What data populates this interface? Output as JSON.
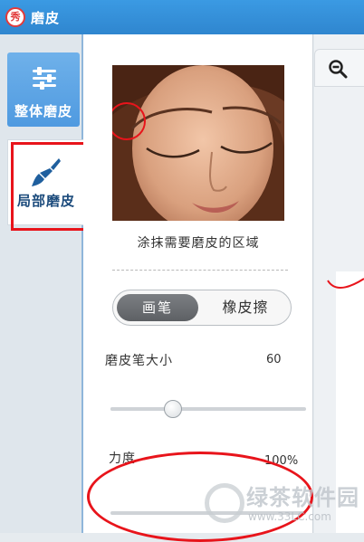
{
  "titlebar": {
    "app_logo_text": "秀",
    "title": "磨皮"
  },
  "sidebar": {
    "tabs": [
      {
        "label": "整体磨皮",
        "icon": "sliders-icon",
        "active": false
      },
      {
        "label": "局部磨皮",
        "icon": "brush-icon",
        "active": true
      }
    ]
  },
  "panel": {
    "preview_caption": "涂抹需要磨皮的区域",
    "mode_toggle": {
      "options": [
        "画笔",
        "橡皮擦"
      ],
      "selected": "画笔"
    },
    "brush_size": {
      "label": "磨皮笔大小",
      "value": "60",
      "level": 0.32
    },
    "strength": {
      "label": "力度",
      "value": "100%"
    }
  },
  "canvas": {
    "zoom_icon": "zoom-out-icon"
  },
  "watermark": {
    "title": "绿茶软件园",
    "url": "www.33LC.com"
  },
  "colors": {
    "titlebar": "#2f86cf",
    "active_tab": "#5aa5e6",
    "annotation_red": "#e8141b"
  }
}
